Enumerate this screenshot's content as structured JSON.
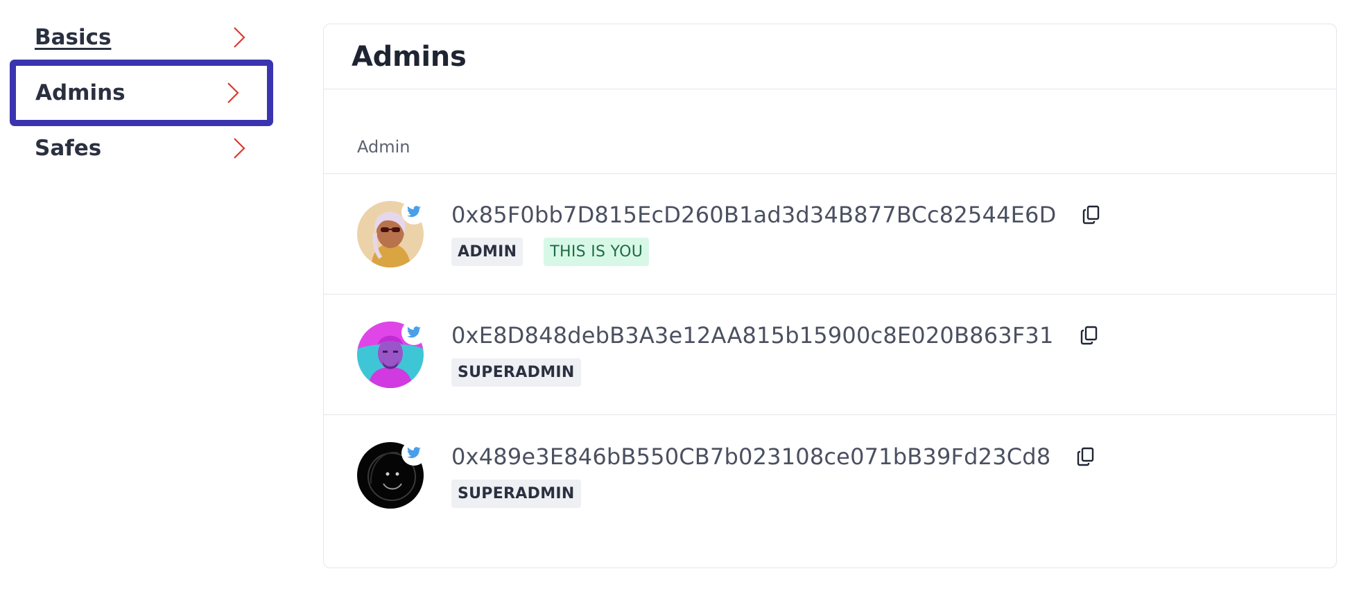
{
  "sidebar": {
    "items": [
      {
        "label": "Basics"
      },
      {
        "label": "Admins"
      },
      {
        "label": "Safes"
      }
    ]
  },
  "card": {
    "title": "Admins",
    "column_header": "Admin"
  },
  "admins": [
    {
      "address": "0x85F0bb7D815EcD260B1ad3d34B877BCc82544E6D",
      "role": "ADMIN",
      "you_badge": "THIS IS YOU"
    },
    {
      "address": "0xE8D848debB3A3e12AA815b15900c8E020B863F31",
      "role": "SUPERADMIN"
    },
    {
      "address": "0x489e3E846bB550CB7b023108ce071bB39Fd23Cd8",
      "role": "SUPERADMIN"
    }
  ],
  "colors": {
    "active_outline": "#3a34b0",
    "chevron": "#d93a2b",
    "twitter": "#4a9fe8",
    "you_badge_bg": "#d8f8e7"
  },
  "icons": [
    "chevron-right-icon",
    "twitter-icon",
    "copy-icon"
  ]
}
